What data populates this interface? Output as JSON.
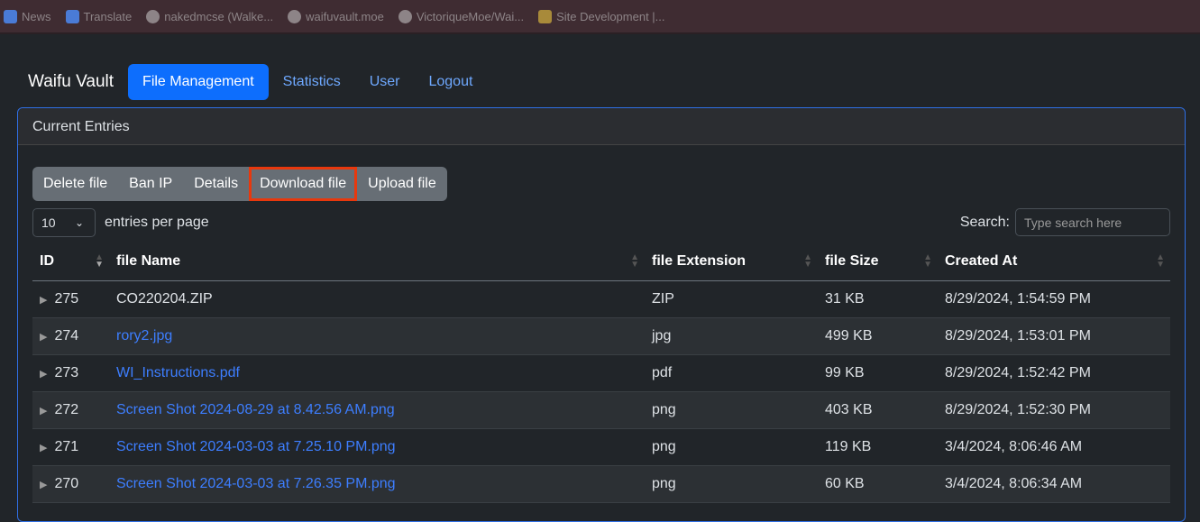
{
  "bookmarks": [
    {
      "label": "News",
      "icon": "google-news-icon"
    },
    {
      "label": "Translate",
      "icon": "google-translate-icon"
    },
    {
      "label": "nakedmcse (Walke...",
      "icon": "github-icon"
    },
    {
      "label": "waifuvault.moe",
      "icon": "github-icon"
    },
    {
      "label": "VictoriqueMoe/Wai...",
      "icon": "github-icon"
    },
    {
      "label": "Site Development |...",
      "icon": "site-icon"
    }
  ],
  "nav": {
    "brand": "Waifu Vault",
    "links": [
      "File Management",
      "Statistics",
      "User",
      "Logout"
    ],
    "active": "File Management"
  },
  "card": {
    "title": "Current Entries"
  },
  "toolbar": {
    "buttons": [
      "Delete file",
      "Ban IP",
      "Details",
      "Download file",
      "Upload file"
    ],
    "highlighted": "Download file"
  },
  "length": {
    "value": "10",
    "label": "entries per page"
  },
  "search": {
    "label": "Search:",
    "placeholder": "Type search here"
  },
  "table": {
    "headers": [
      "ID",
      "file Name",
      "file Extension",
      "file Size",
      "Created At"
    ],
    "rows": [
      {
        "id": "275",
        "name": "CO220204.ZIP",
        "ext": "ZIP",
        "size": "31 KB",
        "created": "8/29/2024, 1:54:59 PM",
        "link": false
      },
      {
        "id": "274",
        "name": "rory2.jpg",
        "ext": "jpg",
        "size": "499 KB",
        "created": "8/29/2024, 1:53:01 PM",
        "link": true
      },
      {
        "id": "273",
        "name": "WI_Instructions.pdf",
        "ext": "pdf",
        "size": "99 KB",
        "created": "8/29/2024, 1:52:42 PM",
        "link": true
      },
      {
        "id": "272",
        "name": "Screen Shot 2024-08-29 at 8.42.56 AM.png",
        "ext": "png",
        "size": "403 KB",
        "created": "8/29/2024, 1:52:30 PM",
        "link": true
      },
      {
        "id": "271",
        "name": "Screen Shot 2024-03-03 at 7.25.10 PM.png",
        "ext": "png",
        "size": "119 KB",
        "created": "3/4/2024, 8:06:46 AM",
        "link": true
      },
      {
        "id": "270",
        "name": "Screen Shot 2024-03-03 at 7.26.35 PM.png",
        "ext": "png",
        "size": "60 KB",
        "created": "3/4/2024, 8:06:34 AM",
        "link": true
      }
    ]
  },
  "colors": {
    "accent": "#0d6efd",
    "link": "#3d7eff",
    "highlight": "#e8380d"
  }
}
